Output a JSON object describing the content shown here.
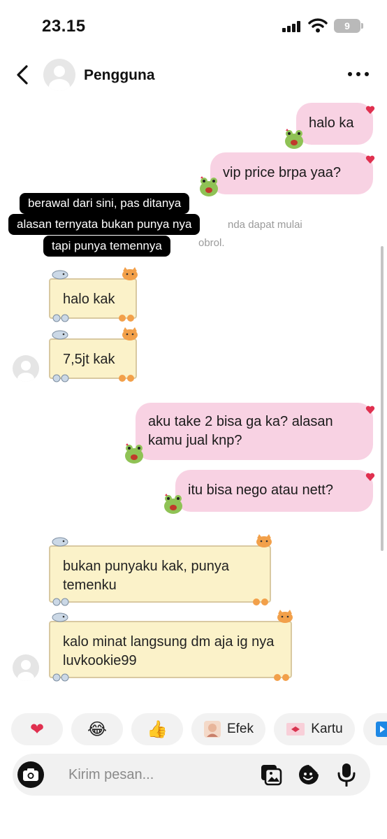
{
  "status": {
    "time": "23.15",
    "battery": "9"
  },
  "header": {
    "name": "Pengguna"
  },
  "overlay_caption": [
    "berawal dari sini, pas ditanya",
    "alasan ternyata bukan punya nya",
    "tapi punya temennya"
  ],
  "system_hint": [
    "nda dapat mulai",
    "obrol."
  ],
  "messages": [
    {
      "side": "out",
      "text": "halo ka"
    },
    {
      "side": "out",
      "text": "vip price brpa yaa?"
    },
    {
      "side": "in",
      "text": "halo kak"
    },
    {
      "side": "in",
      "text": "7,5jt kak"
    },
    {
      "side": "out",
      "text": "aku take 2 bisa ga ka? alasan kamu jual knp?"
    },
    {
      "side": "out",
      "text": "itu bisa nego atau nett?"
    },
    {
      "side": "in",
      "text": "bukan punyaku kak, punya temenku"
    },
    {
      "side": "in",
      "text": "kalo minat langsung dm aja ig nya luvkookie99"
    }
  ],
  "reactions": {
    "effects_label": "Efek",
    "card_label": "Kartu",
    "emojis": [
      "❤",
      "😂",
      "👍"
    ]
  },
  "composer": {
    "placeholder": "Kirim pesan..."
  },
  "colors": {
    "out_bubble": "#f8d2e3",
    "in_card": "#fbf2c9",
    "heart": "#e0304f"
  }
}
